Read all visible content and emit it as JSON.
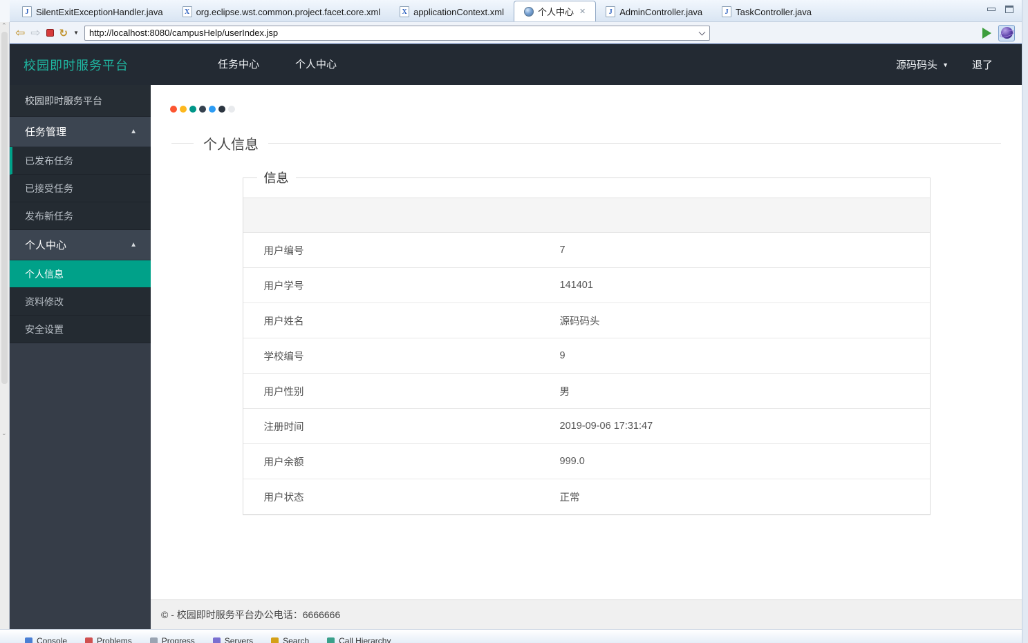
{
  "eclipse": {
    "editor_tabs": [
      {
        "label": "SilentExitExceptionHandler.java",
        "icon": "java-file-icon"
      },
      {
        "label": "org.eclipse.wst.common.project.facet.core.xml",
        "icon": "xml-file-icon"
      },
      {
        "label": "applicationContext.xml",
        "icon": "xml-file-icon"
      },
      {
        "label": "个人中心",
        "icon": "globe-icon",
        "active": true
      },
      {
        "label": "AdminController.java",
        "icon": "java-file-icon"
      },
      {
        "label": "TaskController.java",
        "icon": "java-file-icon"
      }
    ],
    "icon_glyphs": {
      "java_letter": "J",
      "xml_letter": "X",
      "close": "✕",
      "back": "⇦",
      "forward": "⇨",
      "refresh": "↻",
      "caret_down_small": "▼",
      "caret_up": "▲"
    },
    "browser_toolbar": {
      "url": "http://localhost:8080/campusHelp/userIndex.jsp"
    },
    "bottom_tabs": [
      "Console",
      "Problems",
      "Progress",
      "Servers",
      "Search",
      "Call Hierarchy"
    ],
    "bottom_tab_icon_colors": [
      "#4a7fd4",
      "#d05050",
      "#9aa4b2",
      "#7a6fd0",
      "#d4a017",
      "#3aa08a"
    ]
  },
  "page": {
    "navbar": {
      "brand": "校园即时服务平台",
      "links": [
        {
          "label": "任务中心"
        },
        {
          "label": "个人中心"
        }
      ],
      "user": "源码码头",
      "logout": "退了"
    },
    "sidebar": {
      "items": [
        {
          "label": "校园即时服务平台"
        },
        {
          "label": "任务管理"
        },
        {
          "label": "已发布任务"
        },
        {
          "label": "已接受任务"
        },
        {
          "label": "发布新任务"
        },
        {
          "label": "个人中心"
        },
        {
          "label": "个人信息"
        },
        {
          "label": "资料修改"
        },
        {
          "label": "安全设置"
        }
      ],
      "active_item": "个人信息",
      "accent_color": "#00a189"
    },
    "dots": [
      "#fc5531",
      "#fdb81e",
      "#009688",
      "#35414e",
      "#2d9cf4",
      "#2c3540",
      "#e8eaed"
    ],
    "content": {
      "heading": "个人信息",
      "panel_legend": "信息",
      "info_rows": [
        {
          "label": "用户编号",
          "value": "7"
        },
        {
          "label": "用户学号",
          "value": "141401"
        },
        {
          "label": "用户姓名",
          "value": "源码码头"
        },
        {
          "label": "学校编号",
          "value": "9"
        },
        {
          "label": "用户性别",
          "value": "男"
        },
        {
          "label": "注册时间",
          "value": "2019-09-06 17:31:47"
        },
        {
          "label": "用户余额",
          "value": "999.0"
        },
        {
          "label": "用户状态",
          "value": "正常"
        }
      ]
    },
    "footer": {
      "text": "© - 校园即时服务平台办公电话：6666666"
    },
    "colors": {
      "navbar_bg": "#232a33",
      "brand": "#1fb5a0",
      "sidebar_active": "#00a189"
    }
  }
}
